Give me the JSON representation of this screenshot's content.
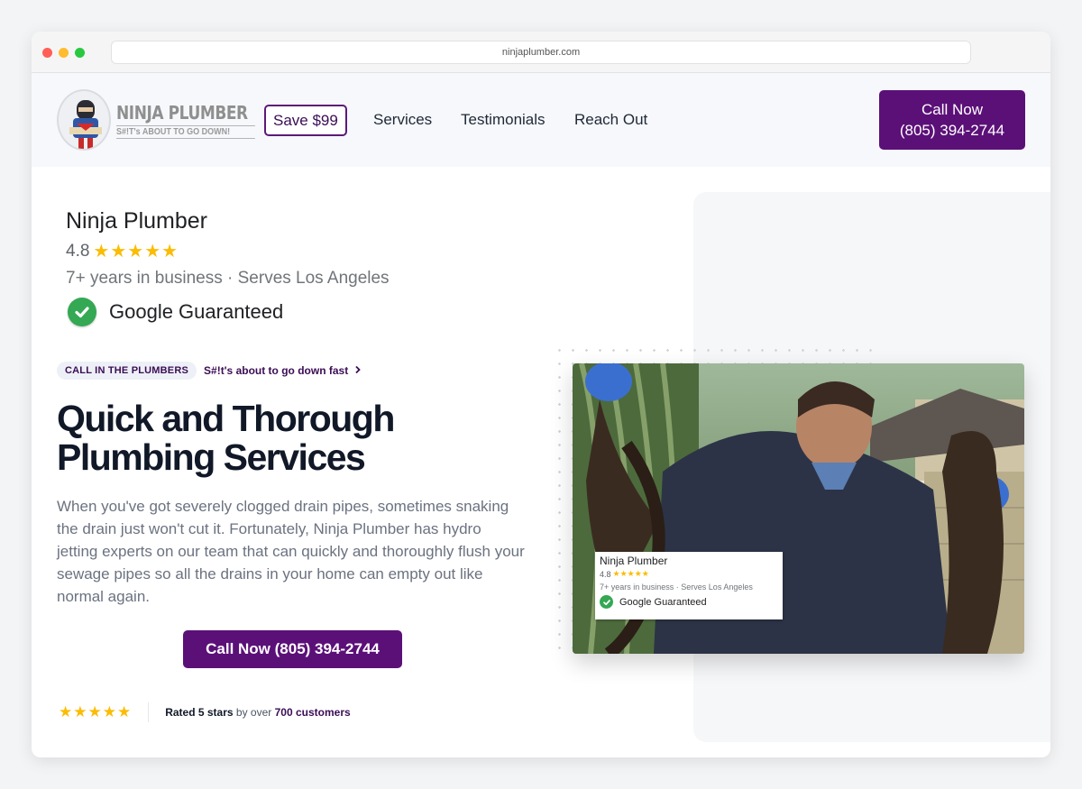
{
  "browser": {
    "url": "ninjaplumber.com"
  },
  "header": {
    "logo_name": "NINJA PLUMBER",
    "logo_tagline": "S#!T's ABOUT TO GO DOWN!",
    "save_label": "Save $99",
    "nav": [
      "Services",
      "Testimonials",
      "Reach Out"
    ],
    "call_label": "Call Now",
    "call_phone": "(805) 394-2744"
  },
  "business_card": {
    "name": "Ninja Plumber",
    "rating": "4.8",
    "stars": "★★★★★",
    "info": "7+ years in business · Serves Los Angeles",
    "guarantee": "Google Guaranteed"
  },
  "hero": {
    "pill": "CALL IN THE PLUMBERS",
    "pill_link": "S#!t's about to go down fast",
    "headline_line1": "Quick and Thorough",
    "headline_line2": "Plumbing Services",
    "body": "When you've got severely clogged drain pipes, sometimes snaking the drain just won't cut it. Fortunately, Ninja Plumber has hydro jetting experts on our team that can quickly and thoroughly flush your sewage pipes so all the drains in your home can empty out like normal again.",
    "cta": "Call Now (805) 394-2744"
  },
  "reviews": {
    "stars": "★★★★★",
    "rated_prefix": "Rated 5 stars",
    "by_over": " by over ",
    "count_text": "700 customers"
  },
  "photo_card": {
    "name": "Ninja Plumber",
    "rating": "4.8",
    "stars": "★★★★★",
    "info": "7+ years in business · Serves Los Angeles",
    "guarantee": "Google Guaranteed"
  },
  "colors": {
    "brand_purple": "#5b1078",
    "star_yellow": "#fbbc04",
    "check_green": "#34a853"
  }
}
